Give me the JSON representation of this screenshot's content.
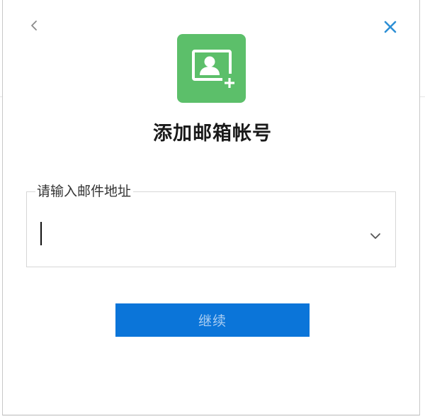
{
  "dialog": {
    "title": "添加邮箱帐号",
    "back_icon": "chevron-left-icon",
    "close_icon": "close-icon",
    "header_icon": "add-contact-icon",
    "header_icon_color": "#5cbf6a",
    "close_color": "#2d8fd5"
  },
  "email_field": {
    "label": "请输入邮件地址",
    "value": "",
    "dropdown_icon": "chevron-down-icon"
  },
  "continue_button": {
    "label": "继续",
    "color": "#0b75d9"
  }
}
